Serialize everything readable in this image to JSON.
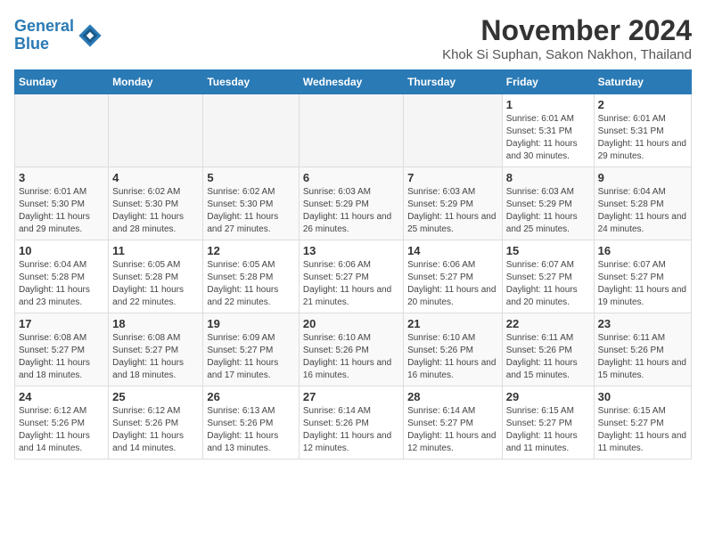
{
  "logo": {
    "line1": "General",
    "line2": "Blue"
  },
  "title": "November 2024",
  "subtitle": "Khok Si Suphan, Sakon Nakhon, Thailand",
  "days_of_week": [
    "Sunday",
    "Monday",
    "Tuesday",
    "Wednesday",
    "Thursday",
    "Friday",
    "Saturday"
  ],
  "weeks": [
    [
      {
        "day": "",
        "info": ""
      },
      {
        "day": "",
        "info": ""
      },
      {
        "day": "",
        "info": ""
      },
      {
        "day": "",
        "info": ""
      },
      {
        "day": "",
        "info": ""
      },
      {
        "day": "1",
        "info": "Sunrise: 6:01 AM\nSunset: 5:31 PM\nDaylight: 11 hours and 30 minutes."
      },
      {
        "day": "2",
        "info": "Sunrise: 6:01 AM\nSunset: 5:31 PM\nDaylight: 11 hours and 29 minutes."
      }
    ],
    [
      {
        "day": "3",
        "info": "Sunrise: 6:01 AM\nSunset: 5:30 PM\nDaylight: 11 hours and 29 minutes."
      },
      {
        "day": "4",
        "info": "Sunrise: 6:02 AM\nSunset: 5:30 PM\nDaylight: 11 hours and 28 minutes."
      },
      {
        "day": "5",
        "info": "Sunrise: 6:02 AM\nSunset: 5:30 PM\nDaylight: 11 hours and 27 minutes."
      },
      {
        "day": "6",
        "info": "Sunrise: 6:03 AM\nSunset: 5:29 PM\nDaylight: 11 hours and 26 minutes."
      },
      {
        "day": "7",
        "info": "Sunrise: 6:03 AM\nSunset: 5:29 PM\nDaylight: 11 hours and 25 minutes."
      },
      {
        "day": "8",
        "info": "Sunrise: 6:03 AM\nSunset: 5:29 PM\nDaylight: 11 hours and 25 minutes."
      },
      {
        "day": "9",
        "info": "Sunrise: 6:04 AM\nSunset: 5:28 PM\nDaylight: 11 hours and 24 minutes."
      }
    ],
    [
      {
        "day": "10",
        "info": "Sunrise: 6:04 AM\nSunset: 5:28 PM\nDaylight: 11 hours and 23 minutes."
      },
      {
        "day": "11",
        "info": "Sunrise: 6:05 AM\nSunset: 5:28 PM\nDaylight: 11 hours and 22 minutes."
      },
      {
        "day": "12",
        "info": "Sunrise: 6:05 AM\nSunset: 5:28 PM\nDaylight: 11 hours and 22 minutes."
      },
      {
        "day": "13",
        "info": "Sunrise: 6:06 AM\nSunset: 5:27 PM\nDaylight: 11 hours and 21 minutes."
      },
      {
        "day": "14",
        "info": "Sunrise: 6:06 AM\nSunset: 5:27 PM\nDaylight: 11 hours and 20 minutes."
      },
      {
        "day": "15",
        "info": "Sunrise: 6:07 AM\nSunset: 5:27 PM\nDaylight: 11 hours and 20 minutes."
      },
      {
        "day": "16",
        "info": "Sunrise: 6:07 AM\nSunset: 5:27 PM\nDaylight: 11 hours and 19 minutes."
      }
    ],
    [
      {
        "day": "17",
        "info": "Sunrise: 6:08 AM\nSunset: 5:27 PM\nDaylight: 11 hours and 18 minutes."
      },
      {
        "day": "18",
        "info": "Sunrise: 6:08 AM\nSunset: 5:27 PM\nDaylight: 11 hours and 18 minutes."
      },
      {
        "day": "19",
        "info": "Sunrise: 6:09 AM\nSunset: 5:27 PM\nDaylight: 11 hours and 17 minutes."
      },
      {
        "day": "20",
        "info": "Sunrise: 6:10 AM\nSunset: 5:26 PM\nDaylight: 11 hours and 16 minutes."
      },
      {
        "day": "21",
        "info": "Sunrise: 6:10 AM\nSunset: 5:26 PM\nDaylight: 11 hours and 16 minutes."
      },
      {
        "day": "22",
        "info": "Sunrise: 6:11 AM\nSunset: 5:26 PM\nDaylight: 11 hours and 15 minutes."
      },
      {
        "day": "23",
        "info": "Sunrise: 6:11 AM\nSunset: 5:26 PM\nDaylight: 11 hours and 15 minutes."
      }
    ],
    [
      {
        "day": "24",
        "info": "Sunrise: 6:12 AM\nSunset: 5:26 PM\nDaylight: 11 hours and 14 minutes."
      },
      {
        "day": "25",
        "info": "Sunrise: 6:12 AM\nSunset: 5:26 PM\nDaylight: 11 hours and 14 minutes."
      },
      {
        "day": "26",
        "info": "Sunrise: 6:13 AM\nSunset: 5:26 PM\nDaylight: 11 hours and 13 minutes."
      },
      {
        "day": "27",
        "info": "Sunrise: 6:14 AM\nSunset: 5:26 PM\nDaylight: 11 hours and 12 minutes."
      },
      {
        "day": "28",
        "info": "Sunrise: 6:14 AM\nSunset: 5:27 PM\nDaylight: 11 hours and 12 minutes."
      },
      {
        "day": "29",
        "info": "Sunrise: 6:15 AM\nSunset: 5:27 PM\nDaylight: 11 hours and 11 minutes."
      },
      {
        "day": "30",
        "info": "Sunrise: 6:15 AM\nSunset: 5:27 PM\nDaylight: 11 hours and 11 minutes."
      }
    ]
  ]
}
